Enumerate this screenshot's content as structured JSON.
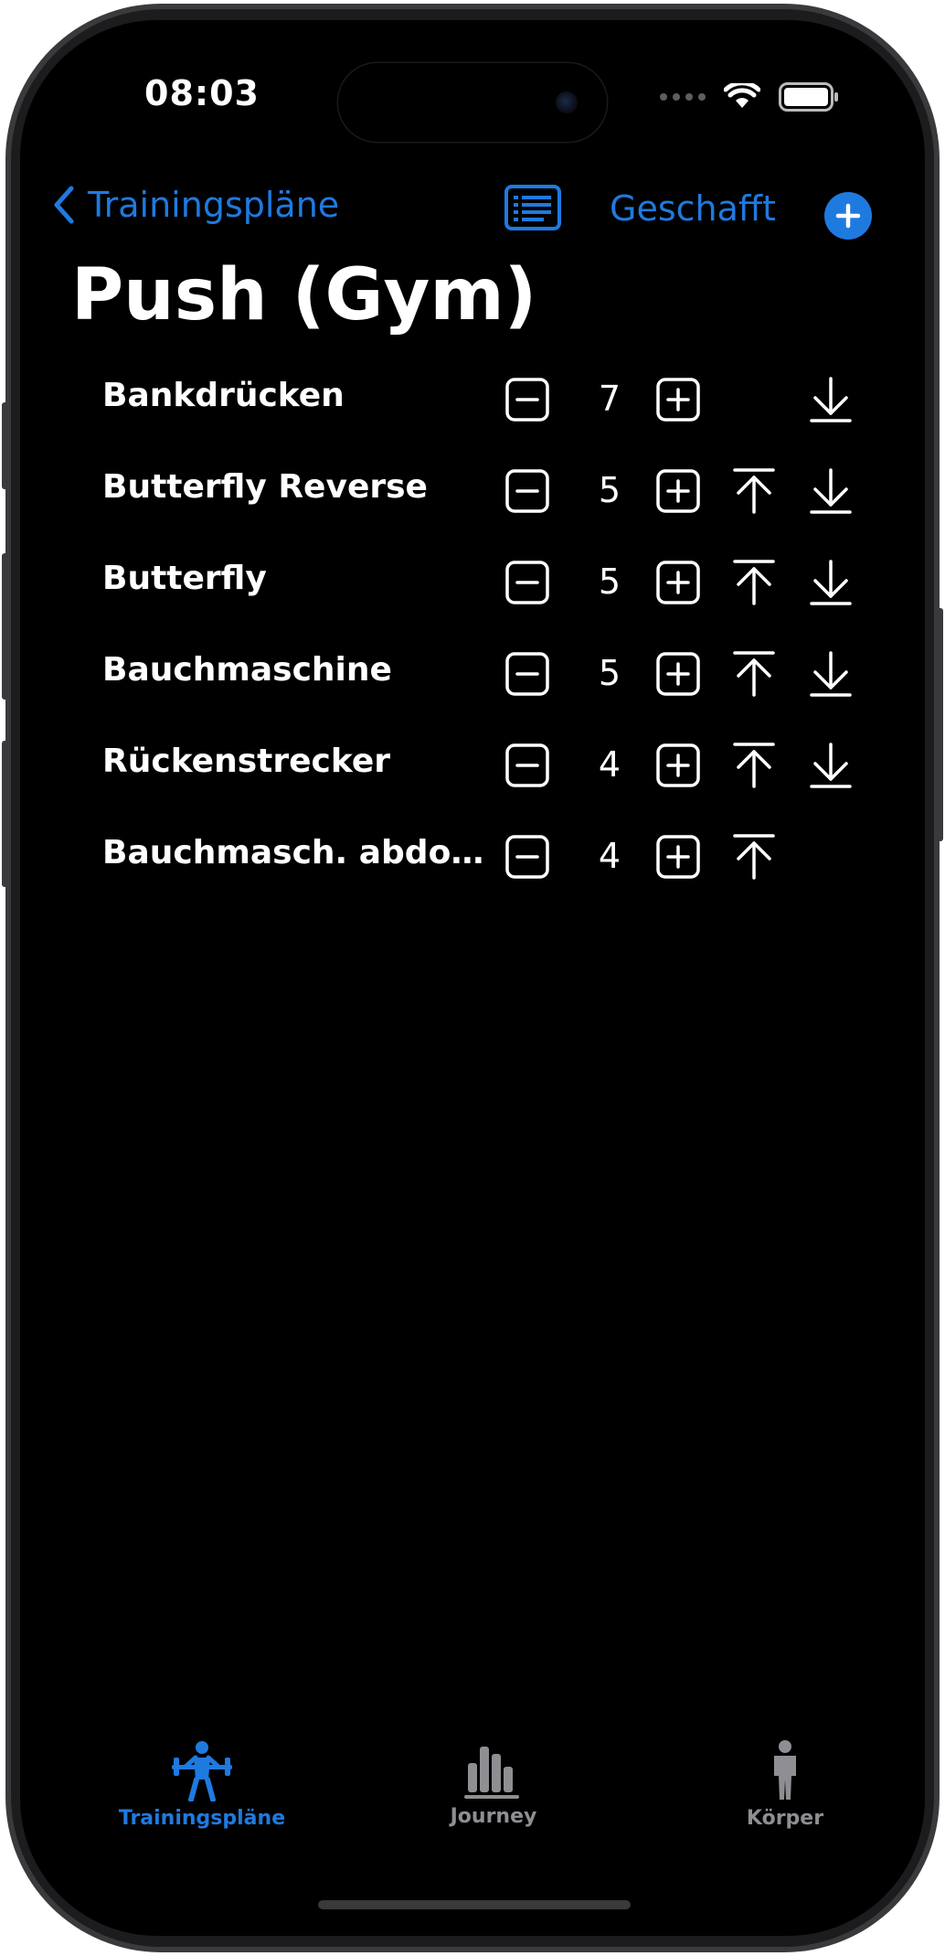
{
  "status_bar": {
    "time": "08:03"
  },
  "nav": {
    "back_label": "Trainingspläne",
    "done_label": "Geschafft"
  },
  "page_title": "Push (Gym)",
  "exercises": [
    {
      "name": "Bankdrücken",
      "count": "7",
      "can_move_up": false,
      "can_move_down": true
    },
    {
      "name": "Butterfly Reverse",
      "count": "5",
      "can_move_up": true,
      "can_move_down": true
    },
    {
      "name": "Butterfly",
      "count": "5",
      "can_move_up": true,
      "can_move_down": true
    },
    {
      "name": "Bauchmaschine",
      "count": "5",
      "can_move_up": true,
      "can_move_down": true
    },
    {
      "name": "Rückenstrecker",
      "count": "4",
      "can_move_up": true,
      "can_move_down": true
    },
    {
      "name": "Bauchmasch. abdo...",
      "count": "4",
      "can_move_up": true,
      "can_move_down": false
    }
  ],
  "tab_bar": {
    "tabs": [
      {
        "label": "Trainingspläne",
        "icon": "weightlifter-icon",
        "active": true
      },
      {
        "label": "Journey",
        "icon": "bar-chart-icon",
        "active": false
      },
      {
        "label": "Körper",
        "icon": "person-icon",
        "active": false
      }
    ]
  },
  "colors": {
    "accent": "#1f7ae0",
    "inactive_tab": "#8e8e93",
    "background": "#000000",
    "text": "#ffffff"
  }
}
